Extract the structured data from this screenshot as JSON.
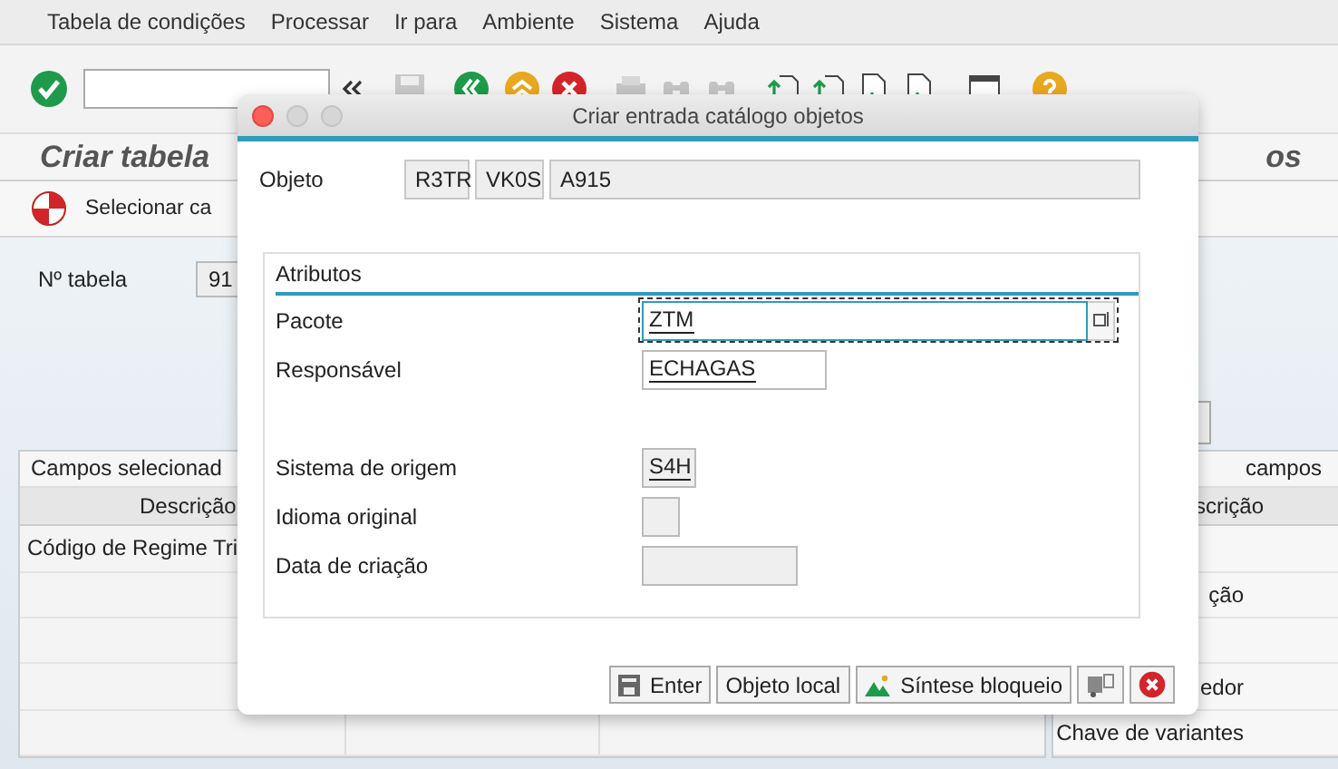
{
  "menu": [
    "Tabela de condições",
    "Processar",
    "Ir para",
    "Ambiente",
    "Sistema",
    "Ajuda"
  ],
  "page_title": {
    "visible_start": "Criar tabela",
    "visible_end": "os"
  },
  "app_toolbar": {
    "button": "Selecionar ca"
  },
  "table_number": {
    "label": "Nº tabela",
    "value": "91"
  },
  "left_panel": {
    "tab": "Campos selecionad",
    "columns": [
      "Descrição"
    ],
    "rows": [
      {
        "text": "Código de Regime Tri"
      },
      {},
      {},
      {},
      {}
    ]
  },
  "right_panel": {
    "tab": "campos",
    "columns": [
      "scrição"
    ],
    "rows": [
      {},
      {
        "text": "ção"
      },
      {},
      {
        "text": "edor"
      },
      {
        "text": "Chave de variantes"
      }
    ]
  },
  "dialog": {
    "title": "Criar entrada catálogo objetos",
    "object": {
      "label": "Objeto",
      "values": [
        "R3TR",
        "VK0S",
        "A915"
      ]
    },
    "group": {
      "title": "Atributos",
      "fields": [
        {
          "label": "Pacote",
          "value": "ZTM",
          "editable": true,
          "focused": true,
          "value_help": true,
          "group_break": false
        },
        {
          "label": "Responsável",
          "value": "ECHAGAS",
          "editable": true,
          "focused": false,
          "value_help": false,
          "group_break": false
        },
        {
          "label": "Sistema de origem",
          "value": "S4H",
          "editable": false,
          "focused": false,
          "value_help": false,
          "group_break": true
        },
        {
          "label": "Idioma original",
          "editable": false,
          "focused": false,
          "value_help": false,
          "group_break": false
        },
        {
          "label": "Data de criação",
          "editable": false,
          "focused": false,
          "value_help": false,
          "group_break": false
        }
      ]
    },
    "buttons": [
      {
        "kind": "enter",
        "label": "Enter"
      },
      {
        "kind": "text",
        "label": "Objeto local"
      },
      {
        "kind": "lock",
        "label": "Síntese bloqueio"
      },
      {
        "kind": "transport"
      },
      {
        "kind": "cancel"
      }
    ]
  }
}
